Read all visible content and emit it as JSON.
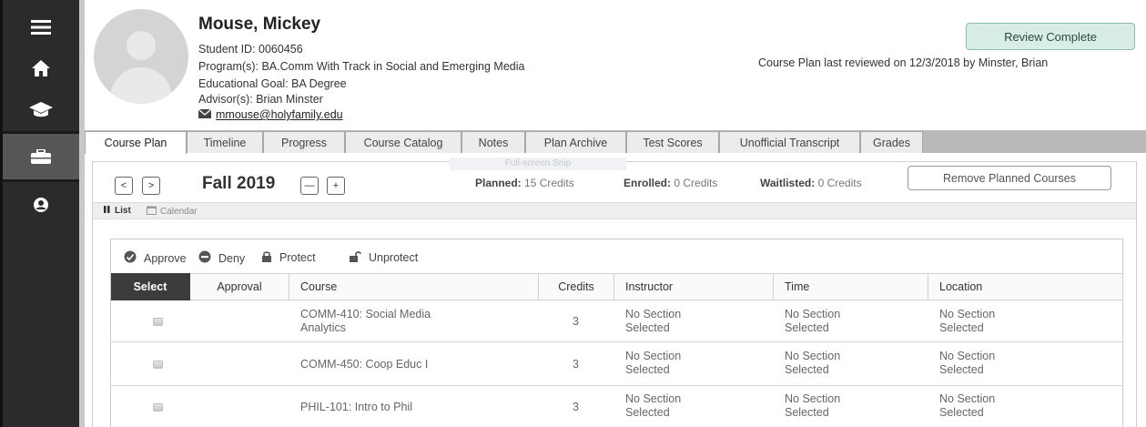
{
  "student": {
    "name": "Mouse, Mickey",
    "student_id": "Student ID: 0060456",
    "programs": "Program(s): BA.Comm With Track in Social and Emerging Media",
    "goal": "Educational Goal: BA Degree",
    "advisors": "Advisor(s): Brian Minster",
    "email": "mmouse@holyfamily.edu"
  },
  "review": {
    "button_label": "Review Complete",
    "last_reviewed": "Course Plan last reviewed on 12/3/2018 by Minster, Brian"
  },
  "tabs": [
    {
      "label": "Course Plan",
      "active": true
    },
    {
      "label": "Timeline"
    },
    {
      "label": "Progress"
    },
    {
      "label": "Course Catalog"
    },
    {
      "label": "Notes"
    },
    {
      "label": "Plan Archive"
    },
    {
      "label": "Test Scores"
    },
    {
      "label": "Unofficial Transcript"
    },
    {
      "label": "Grades"
    }
  ],
  "term": {
    "prev": "<",
    "next": ">",
    "title": "Fall 2019",
    "minus": "—",
    "plus": "+",
    "planned_label": "Planned:",
    "planned_value": "15 Credits",
    "enrolled_label": "Enrolled:",
    "enrolled_value": "0 Credits",
    "waitlisted_label": "Waitlisted:",
    "waitlisted_value": "0 Credits",
    "remove_label": "Remove Planned Courses",
    "snip_text": "Full-screen Snip"
  },
  "views": {
    "list": "List",
    "calendar": "Calendar"
  },
  "actions": {
    "approve": "Approve",
    "deny": "Deny",
    "protect": "Protect",
    "unprotect": "Unprotect"
  },
  "columns": [
    "Select",
    "Approval",
    "Course",
    "Credits",
    "Instructor",
    "Time",
    "Location"
  ],
  "rows": [
    {
      "course_line1": "COMM-410: Social Media",
      "course_line2": "Analytics",
      "credits": "3",
      "instructor_line1": "No Section",
      "instructor_line2": "Selected",
      "time_line1": "No Section",
      "time_line2": "Selected",
      "location_line1": "No Section",
      "location_line2": "Selected"
    },
    {
      "course_line1": "COMM-450: Coop Educ I",
      "course_line2": "",
      "credits": "3",
      "instructor_line1": "No Section",
      "instructor_line2": "Selected",
      "time_line1": "No Section",
      "time_line2": "Selected",
      "location_line1": "No Section",
      "location_line2": "Selected"
    },
    {
      "course_line1": "PHIL-101: Intro to Phil",
      "course_line2": "",
      "credits": "3",
      "instructor_line1": "No Section",
      "instructor_line2": "Selected",
      "time_line1": "No Section",
      "time_line2": "Selected",
      "location_line1": "No Section",
      "location_line2": "Selected"
    }
  ]
}
